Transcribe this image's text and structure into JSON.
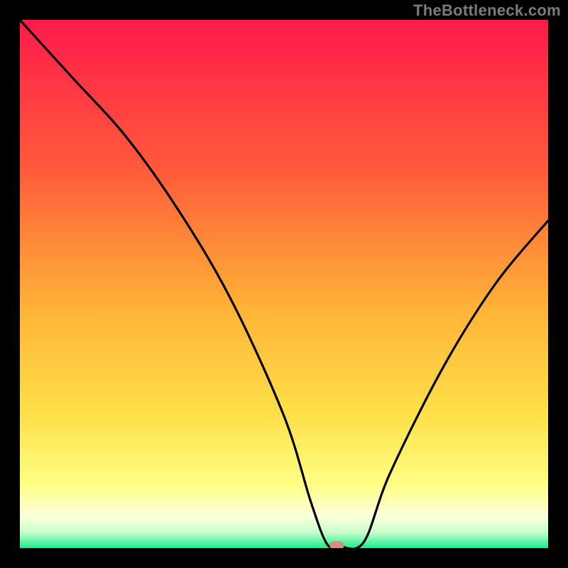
{
  "watermark": "TheBottleneck.com",
  "chart_data": {
    "type": "line",
    "title": "",
    "xlabel": "",
    "ylabel": "",
    "xlim": [
      0,
      100
    ],
    "ylim": [
      0,
      100
    ],
    "grid": false,
    "legend": false,
    "series": [
      {
        "name": "curve",
        "x": [
          0,
          10,
          20,
          30,
          40,
          50,
          55,
          58,
          60,
          65,
          70,
          80,
          90,
          100
        ],
        "values": [
          100,
          89,
          78,
          64,
          47,
          25,
          9,
          1,
          0.5,
          1,
          14,
          34,
          50,
          62
        ]
      }
    ],
    "marker": {
      "x": 60,
      "y": 0.5,
      "color": "#d98d80"
    },
    "gradient_stops": [
      {
        "offset": 0,
        "color": "#ff1a4b"
      },
      {
        "offset": 28,
        "color": "#ff5a3a"
      },
      {
        "offset": 55,
        "color": "#ffb437"
      },
      {
        "offset": 75,
        "color": "#ffe04a"
      },
      {
        "offset": 88,
        "color": "#ffff84"
      },
      {
        "offset": 94,
        "color": "#fbffda"
      },
      {
        "offset": 97,
        "color": "#c9ffcb"
      },
      {
        "offset": 100,
        "color": "#18ec8f"
      }
    ],
    "curve_color": "#000000",
    "curve_width": 3.2
  }
}
